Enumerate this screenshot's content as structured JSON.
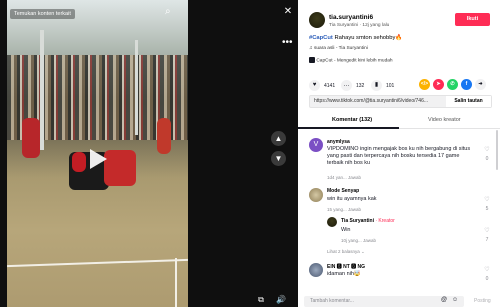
{
  "video": {
    "title": "Temukan konten terkait",
    "more_label": "•••"
  },
  "author": {
    "username": "tia.suryantini6",
    "display_line": "Tia Suryantini · 12j yang lalu",
    "follow_label": "Ikuti"
  },
  "post": {
    "hashtag": "#CapCut",
    "caption": " Rahayu smton sehobby🔥",
    "sound": "suara asli - Tia Suryantini",
    "capcut_line": "CapCut - Mengedit kini lebih mudah"
  },
  "stats": {
    "likes": "4141",
    "comments": "132",
    "saves": "101"
  },
  "share": {
    "link": "https://www.tiktok.com/@tia.suryantini6/video/746...",
    "copy_label": "Salin tautan"
  },
  "tabs": [
    {
      "label": "Komentar (132)",
      "active": true
    },
    {
      "label": "Video kreator",
      "active": false
    }
  ],
  "comments": [
    {
      "username": "anymlysa",
      "text": "VIPDOMINO ingin mengajak bos ku nih bergabung di situs yang pasti dan terpercaya nih bosku tersedia 17 game terbaik nih bos ku",
      "meta": "1d4 yan...   Jawab",
      "likes": "0"
    },
    {
      "username": "Mode Senyap",
      "text": "win itu ayamnya kak",
      "meta": "15 yang...   Jawab",
      "likes": "5",
      "reply": {
        "username": "Tia Suryantini",
        "creator_label": " · Kreator",
        "text": "Win",
        "meta": "10j yang...   Jawab",
        "likes": "7"
      },
      "view_replies": "Lihat 2 balasnya ⌄"
    },
    {
      "username": "EIN 🅱 NT 🅱 NG",
      "text": "idaman nih🤯",
      "meta": "",
      "likes": "0"
    }
  ],
  "composer": {
    "placeholder": "Tambah komentar...",
    "post_label": "Posting"
  },
  "colors": {
    "accent": "#fe2c55",
    "hashtag": "#2b5db9",
    "muted": "#8a8b91"
  }
}
